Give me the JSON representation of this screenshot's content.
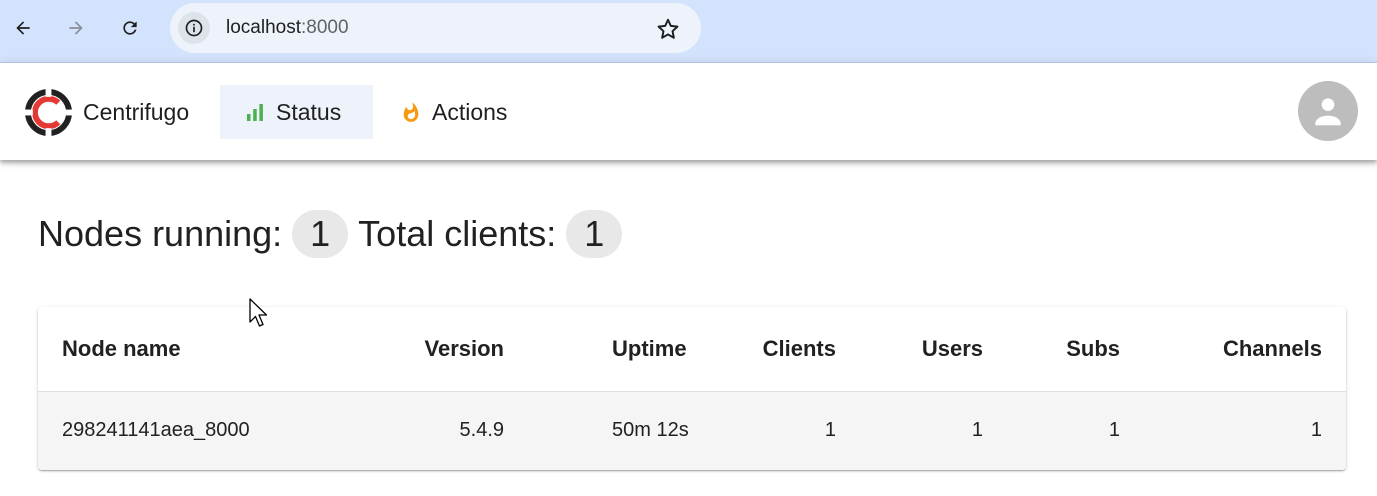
{
  "browser": {
    "url_host": "localhost",
    "url_port": ":8000"
  },
  "app": {
    "brand": "Centrifugo",
    "tabs": [
      {
        "label": "Status",
        "icon": "bar-chart-icon",
        "active": true
      },
      {
        "label": "Actions",
        "icon": "fire-icon",
        "active": false
      }
    ],
    "accent": "#4caf50",
    "fire_color": "#f59a12",
    "logo_colors": [
      "#e53935",
      "#212121"
    ]
  },
  "summary": {
    "nodes_label": "Nodes running:",
    "nodes_value": "1",
    "clients_label": "Total clients:",
    "clients_value": "1"
  },
  "table": {
    "headers": [
      "Node name",
      "Version",
      "Uptime",
      "Clients",
      "Users",
      "Subs",
      "Channels"
    ],
    "rows": [
      [
        "298241141aea_8000",
        "5.4.9",
        "50m 12s",
        "1",
        "1",
        "1",
        "1"
      ]
    ]
  }
}
